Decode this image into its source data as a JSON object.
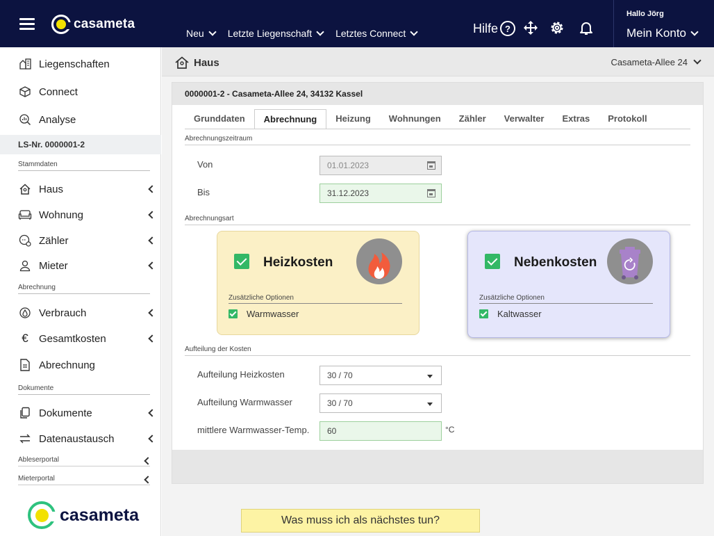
{
  "brand": {
    "name": "casameta",
    "accent": "#0c1340",
    "logo_dot": "#f2e100",
    "logo_ring_green": "#2ec27e"
  },
  "topnav": [
    {
      "label": "Neu"
    },
    {
      "label": "Letzte Liegenschaft"
    },
    {
      "label": "Letztes Connect"
    }
  ],
  "help": {
    "label": "Hilfe"
  },
  "account": {
    "greeting": "Hallo Jörg",
    "label": "Mein Konto"
  },
  "sidebar": {
    "top_items": [
      {
        "label": "Liegenschaften",
        "icon": "building-icon"
      },
      {
        "label": "Connect",
        "icon": "cube-icon"
      },
      {
        "label": "Analyse",
        "icon": "analysis-icon"
      }
    ],
    "lsnr": "LS-Nr. 0000001-2",
    "sections": {
      "stammdaten": "Stammdaten",
      "abrechnung": "Abrechnung",
      "dokumente": "Dokumente",
      "ableserportal": "Ableserportal",
      "mieterportal": "Mieterportal"
    },
    "stammdaten_items": [
      {
        "label": "Haus",
        "icon": "house-icon"
      },
      {
        "label": "Wohnung",
        "icon": "sofa-icon"
      },
      {
        "label": "Zähler",
        "icon": "meter-icon"
      },
      {
        "label": "Mieter",
        "icon": "person-icon"
      }
    ],
    "abrechnung_items": [
      {
        "label": "Verbrauch",
        "icon": "drop-icon"
      },
      {
        "label": "Gesamtkosten",
        "icon": "euro-icon"
      },
      {
        "label": "Abrechnung",
        "icon": "document-icon"
      }
    ],
    "dokumente_items": [
      {
        "label": "Dokumente",
        "icon": "copy-icon"
      },
      {
        "label": "Datenaustausch",
        "icon": "exchange-icon"
      }
    ]
  },
  "page": {
    "title": "Haus",
    "address_select": "Casameta-Allee 24"
  },
  "card": {
    "header": "0000001-2 - Casameta-Allee 24, 34132 Kassel",
    "tabs": [
      "Grunddaten",
      "Abrechnung",
      "Heizung",
      "Wohnungen",
      "Zähler",
      "Verwalter",
      "Extras",
      "Protokoll"
    ],
    "active_tab": "Abrechnung"
  },
  "zeitraum": {
    "section": "Abrechnungszeitraum",
    "von_label": "Von",
    "von_value": "01.01.2023",
    "bis_label": "Bis",
    "bis_value": "31.12.2023"
  },
  "art": {
    "section": "Abrechnungsart",
    "heiz": {
      "title": "Heizkosten",
      "options_label": "Zusätzliche Optionen",
      "option": "Warmwasser",
      "checked": true,
      "icon": "flame-icon"
    },
    "neben": {
      "title": "Nebenkosten",
      "options_label": "Zusätzliche Optionen",
      "option": "Kaltwasser",
      "checked": true,
      "icon": "trash-bin-icon"
    }
  },
  "aufteilung": {
    "section": "Aufteilung der Kosten",
    "heiz_label": "Aufteilung Heizkosten",
    "heiz_value": "30 / 70",
    "ww_label": "Aufteilung Warmwasser",
    "ww_value": "30 / 70",
    "temp_label": "mittlere Warmwasser-Temp.",
    "temp_value": "60",
    "temp_unit": "°C"
  },
  "cta": {
    "label": "Was muss ich als nächstes tun?"
  }
}
